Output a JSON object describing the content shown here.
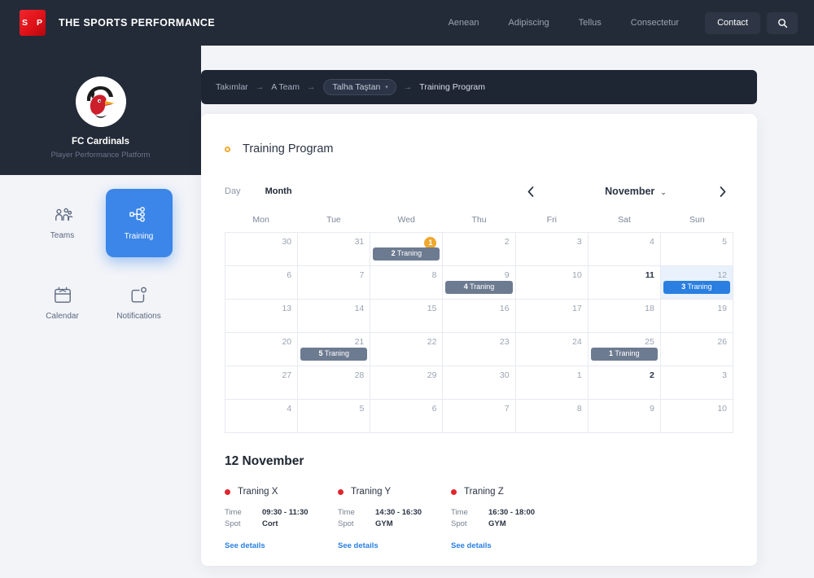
{
  "header": {
    "logo_letters": "S P",
    "brand": "THE SPORTS PERFORMANCE",
    "nav": [
      {
        "label": "Aenean"
      },
      {
        "label": "Adipiscing"
      },
      {
        "label": "Tellus"
      },
      {
        "label": "Consectetur"
      }
    ],
    "contact_label": "Contact",
    "search_icon": "search-icon"
  },
  "club": {
    "name": "FC Cardinals",
    "subtitle": "Player Performance Platform",
    "logo_icon": "cardinal-bird-logo"
  },
  "sidebar": {
    "items": [
      {
        "label": "Teams",
        "icon": "people-group-icon",
        "active": false
      },
      {
        "label": "Training",
        "icon": "node-hierarchy-icon",
        "active": true
      },
      {
        "label": "Calendar",
        "icon": "calendar-icon",
        "active": false
      },
      {
        "label": "Notifications",
        "icon": "notification-bell-icon",
        "active": false
      }
    ]
  },
  "breadcrumb": {
    "items": [
      {
        "label": "Takımlar",
        "type": "link"
      },
      {
        "label": "A Team",
        "type": "link"
      },
      {
        "label": "Talha Taştan",
        "type": "dropdown"
      },
      {
        "label": "Training  Program",
        "type": "current"
      }
    ],
    "arrow": "→",
    "caret": "▾"
  },
  "card": {
    "title": "Training Program",
    "bullet_color": "#efa82e"
  },
  "toolbar": {
    "day_label": "Day",
    "month_label": "Month",
    "active_view": "Month",
    "prev_icon": "chevron-left-icon",
    "next_icon": "chevron-right-icon",
    "current_month": "November",
    "month_caret": "⌄"
  },
  "calendar": {
    "weekdays": [
      "Mon",
      "Tue",
      "Wed",
      "Thu",
      "Fri",
      "Sat",
      "Sun"
    ],
    "today": 1,
    "selected": 12,
    "weeks": [
      [
        {
          "num": "30"
        },
        {
          "num": "31"
        },
        {
          "num": "1",
          "today": true,
          "event": {
            "count": "2",
            "label": "Traning"
          }
        },
        {
          "num": "2"
        },
        {
          "num": "3"
        },
        {
          "num": "4"
        },
        {
          "num": "5"
        }
      ],
      [
        {
          "num": "6"
        },
        {
          "num": "7"
        },
        {
          "num": "8"
        },
        {
          "num": "9",
          "event": {
            "count": "4",
            "label": "Traning"
          }
        },
        {
          "num": "10"
        },
        {
          "num": "11",
          "bold": true
        },
        {
          "num": "12",
          "selected": true,
          "event": {
            "count": "3",
            "label": "Traning",
            "blue": true
          }
        }
      ],
      [
        {
          "num": "13"
        },
        {
          "num": "14"
        },
        {
          "num": "15"
        },
        {
          "num": "16"
        },
        {
          "num": "17"
        },
        {
          "num": "18"
        },
        {
          "num": "19"
        }
      ],
      [
        {
          "num": "20"
        },
        {
          "num": "21",
          "event": {
            "count": "5",
            "label": "Traning"
          }
        },
        {
          "num": "22"
        },
        {
          "num": "23"
        },
        {
          "num": "24"
        },
        {
          "num": "25",
          "event": {
            "count": "1",
            "label": "Traning"
          }
        },
        {
          "num": "26"
        }
      ],
      [
        {
          "num": "27"
        },
        {
          "num": "28"
        },
        {
          "num": "29"
        },
        {
          "num": "30"
        },
        {
          "num": "1"
        },
        {
          "num": "2",
          "bold": true
        },
        {
          "num": "3"
        }
      ],
      [
        {
          "num": "4"
        },
        {
          "num": "5"
        },
        {
          "num": "6"
        },
        {
          "num": "7"
        },
        {
          "num": "8"
        },
        {
          "num": "9"
        },
        {
          "num": "10"
        }
      ]
    ]
  },
  "detail": {
    "date": "12 November",
    "time_key": "Time",
    "spot_key": "Spot",
    "link_label": "See details",
    "events": [
      {
        "name": "Traning X",
        "time": "09:30 - 11:30",
        "spot": "Cort"
      },
      {
        "name": "Traning Y",
        "time": "14:30 - 16:30",
        "spot": "GYM"
      },
      {
        "name": "Traning Z",
        "time": "16:30 - 18:00",
        "spot": "GYM"
      }
    ]
  },
  "colors": {
    "dark": "#232b38",
    "accent_blue": "#3b86e8",
    "brand_red": "#e01118",
    "today_orange": "#efa82e",
    "event_gray": "#6d7b91"
  }
}
